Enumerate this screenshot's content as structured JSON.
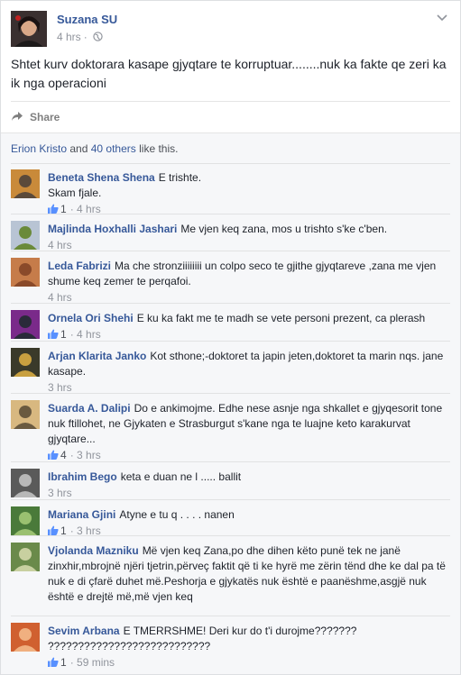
{
  "post": {
    "author": "Suzana SU",
    "time": "4 hrs",
    "separator": "·",
    "audience_icon": "globe-icon",
    "menu_icon": "chevron-down-icon",
    "text": "Shtet kurv doktorara kasape gjyqtare te korruptuar........nuk ka fakte qe zeri ka ik nga operacioni",
    "share_label": "Share"
  },
  "likes": {
    "first_liker": "Erion Kristo",
    "and_text": " and ",
    "others_link": "40 others",
    "suffix": " like this."
  },
  "comments": [
    {
      "name": "Beneta Shena Shena",
      "text": "E trishte.",
      "text2": "Skam fjale.",
      "likes": "1",
      "time": "4 hrs",
      "avatar_colors": [
        "#c98a3a",
        "#5b4a3a"
      ]
    },
    {
      "name": "Majlinda Hoxhalli Jashari",
      "text": "Me vjen keq zana, mos u trishto s'ke c'ben.",
      "likes": "",
      "time": "4 hrs",
      "avatar_colors": [
        "#b8c4d4",
        "#6a8a3a"
      ]
    },
    {
      "name": "Leda Fabrizi",
      "text": "Ma che stronziiiiiiii un colpo seco te gjithe gjyqtareve ,zana me vjen shume keq zemer te perqafoi.",
      "likes": "",
      "time": "4 hrs",
      "avatar_colors": [
        "#c67c4a",
        "#8a4a2a"
      ]
    },
    {
      "name": "Ornela Ori Shehi",
      "text": "E ku ka fakt me te madh se vete personi prezent, ca plerash",
      "likes": "1",
      "time": "4 hrs",
      "avatar_colors": [
        "#7a2a8a",
        "#2a2a3a"
      ]
    },
    {
      "name": "Arjan Klarita Janko",
      "text": "Kot sthone;-doktoret ta japin jeten,doktoret ta marin nqs. jane kasape.",
      "likes": "",
      "time": "3 hrs",
      "avatar_colors": [
        "#3a3a2a",
        "#c8a040"
      ]
    },
    {
      "name": "Suarda A. Dalipi",
      "text": "Do e ankimojme. Edhe nese asnje nga shkallet e gjyqesorit tone nuk ftillohet, ne Gjykaten e Strasburgut s'kane nga te luajne keto karakurvat gjyqtare...",
      "likes": "4",
      "time": "3 hrs",
      "avatar_colors": [
        "#d8b880",
        "#6a5a40"
      ]
    },
    {
      "name": "Ibrahim Bego",
      "text": "keta e duan ne l ..... ballit",
      "likes": "",
      "time": "3 hrs",
      "avatar_colors": [
        "#5a5a5a",
        "#b8b8b8"
      ]
    },
    {
      "name": "Mariana Gjini",
      "text": "Atyne e tu q . . . . nanen",
      "likes": "1",
      "time": "3 hrs",
      "avatar_colors": [
        "#4a7a3a",
        "#9ac070"
      ]
    },
    {
      "name": "Vjolanda Mazniku",
      "text": "Më vjen keq Zana,po dhe dihen këto punë tek ne janë zinxhir,mbrojnë njëri tjetrin,përveç faktit që ti ke hyrë me zërin tënd dhe ke dal pa të nuk e di çfarë duhet më.Peshorja e gjykatës nuk është e paanëshme,asgjë nuk është e drejtë më,më vjen keq",
      "likes": "",
      "time": "",
      "avatar_colors": [
        "#6a8a4a",
        "#c8d0a0"
      ]
    },
    {
      "name": "Sevim Arbana",
      "text": "E TMERRSHME! Deri kur do t'i durojme???????",
      "text2": "???????????????????????????",
      "likes": "1",
      "time": "59 mins",
      "avatar_colors": [
        "#d06030",
        "#f0b080"
      ]
    }
  ],
  "like_icon": "thumbs-up-icon",
  "share_icon": "share-arrow-icon"
}
